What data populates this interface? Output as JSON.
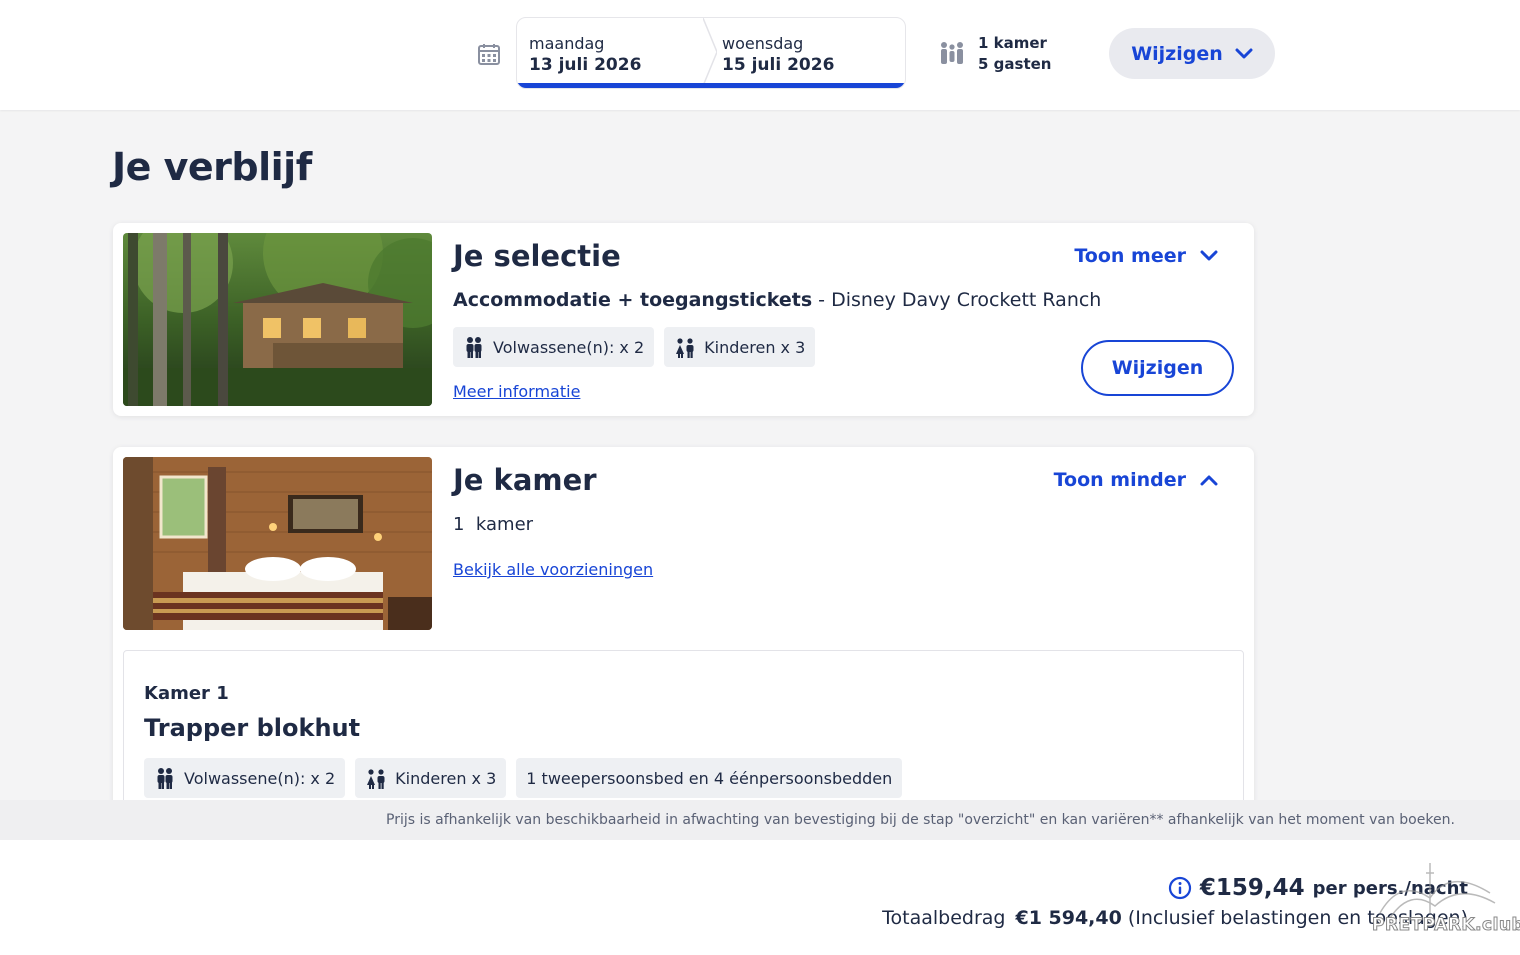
{
  "header": {
    "check_in": {
      "day": "maandag",
      "date": "13 juli 2026"
    },
    "check_out": {
      "day": "woensdag",
      "date": "15 juli 2026"
    },
    "rooms": "1 kamer",
    "guests": "5 gasten",
    "edit_label": "Wijzigen"
  },
  "page": {
    "title": "Je verblijf"
  },
  "selection": {
    "title": "Je selectie",
    "toggle_label": "Toon meer",
    "package": "Accommodatie + toegangstickets",
    "separator": " - ",
    "hotel": "Disney Davy Crockett Ranch",
    "adults": "Volwassene(n): x 2",
    "children": "Kinderen x 3",
    "more_info": "Meer informatie",
    "edit_label": "Wijzigen"
  },
  "room": {
    "title": "Je kamer",
    "toggle_label": "Toon minder",
    "count": "1",
    "count_unit": "kamer",
    "amenities_link": "Bekijk alle voorzieningen",
    "room_label": "Kamer 1",
    "room_name": "Trapper blokhut",
    "adults": "Volwassene(n): x 2",
    "children": "Kinderen x 3",
    "beds": "1 tweepersoonsbed en 4 éénpersoonsbedden"
  },
  "notice": "Prijs is afhankelijk van beschikbaarheid in afwachting van bevestiging bij de stap \"overzicht\" en kan variëren** afhankelijk van het moment van boeken.",
  "footer": {
    "price": "€159,44",
    "price_unit": "per pers./nacht",
    "total_label": "Totaalbedrag",
    "total_value": "€1 594,40",
    "total_note": "(Inclusief belastingen en toeslagen)"
  },
  "watermark": "PRETPARK.club",
  "colors": {
    "accent": "#1845d6",
    "text": "#1f2a44",
    "background": "#f4f4f5"
  }
}
